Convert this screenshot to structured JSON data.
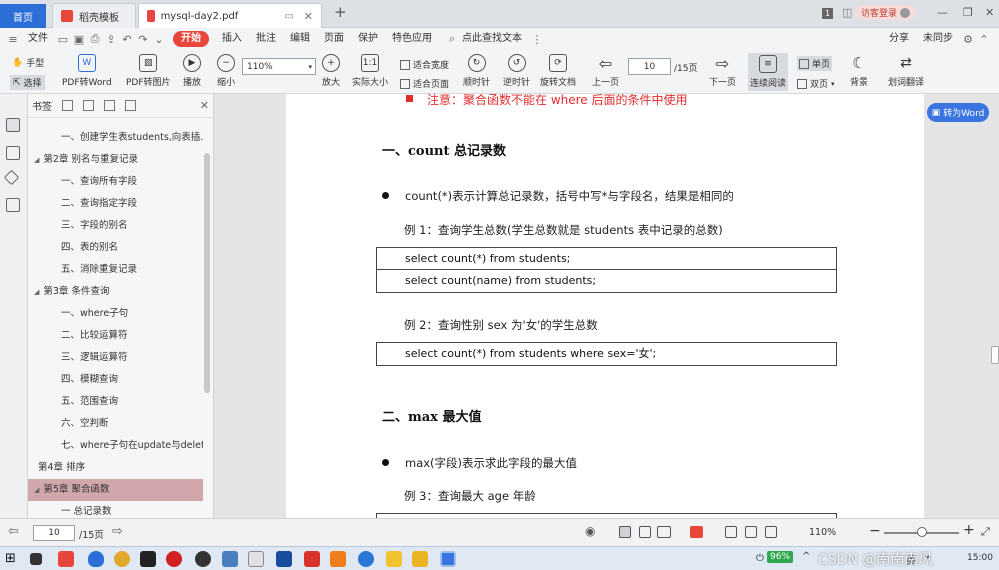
{
  "tabs": {
    "home": "首页",
    "template": "稻壳模板",
    "file": "mysql-day2.pdf",
    "new_tab": "+",
    "page_badge": "1",
    "login": "访客登录"
  },
  "menu": {
    "file": "文件",
    "start": "开始",
    "insert": "插入",
    "annotate": "批注",
    "edit": "编辑",
    "page": "页面",
    "protect": "保护",
    "features": "特色应用",
    "search": "点此查找文本",
    "share": "分享",
    "sync": "未同步"
  },
  "toolbar": {
    "hand": "手型",
    "select": "选择",
    "pdf_word": "PDF转Word",
    "pdf_img": "PDF转图片",
    "play": "播放",
    "zoom_out": "缩小",
    "zoom_value": "110%",
    "zoom_in": "放大",
    "actual": "实际大小",
    "fit_width": "适合宽度",
    "fit_page": "适合页面",
    "cw": "顺时针",
    "ccw": "逆时针",
    "rotate": "旋转文档",
    "prev": "上一页",
    "page_input": "10",
    "page_total": "/15页",
    "next": "下一页",
    "continuous": "连续阅读",
    "single": "单页",
    "double": "双页",
    "background": "背景",
    "translate": "划词翻译"
  },
  "outline": {
    "tab_label": "书签",
    "items": [
      {
        "text": "一、创建学生表students,向表插...",
        "level": 2
      },
      {
        "text": "第2章 别名与重复记录",
        "level": 1,
        "expanded": true
      },
      {
        "text": "一、查询所有字段",
        "level": 2
      },
      {
        "text": "二、查询指定字段",
        "level": 2
      },
      {
        "text": "三、字段的别名",
        "level": 2
      },
      {
        "text": "四、表的别名",
        "level": 2
      },
      {
        "text": "五、消除重复记录",
        "level": 2
      },
      {
        "text": "第3章 条件查询",
        "level": 1,
        "expanded": true
      },
      {
        "text": "一、where子句",
        "level": 2
      },
      {
        "text": "二、比较运算符",
        "level": 2
      },
      {
        "text": "三、逻辑运算符",
        "level": 2
      },
      {
        "text": "四、模糊查询",
        "level": 2
      },
      {
        "text": "五、范围查询",
        "level": 2
      },
      {
        "text": "六、空判断",
        "level": 2
      },
      {
        "text": "七、where子句在update与delet...",
        "level": 2
      },
      {
        "text": "第4章 排序",
        "level": 1
      },
      {
        "text": "第5章 聚合函数",
        "level": 1,
        "expanded": true,
        "selected": true
      },
      {
        "text": "一 总记录数",
        "level": 2
      }
    ]
  },
  "document": {
    "note": "注意：聚合函数不能在 where 后面的条件中使用",
    "section1": "一、count 总记录数",
    "bullet1": "count(*)表示计算总记录数，括号中写*与字段名，结果是相同的",
    "ex1": "例 1：查询学生总数(学生总数就是 students 表中记录的总数)",
    "code1": [
      "select count(*) from students;",
      "select count(name) from students;"
    ],
    "ex2": "例 2：查询性别 sex 为'女'的学生总数",
    "code2": [
      "select count(*) from students where sex='女';"
    ],
    "section2": "二、max 最大值",
    "bullet2": "max(字段)表示求此字段的最大值",
    "ex3": "例 3：查询最大 age 年龄"
  },
  "to_word": "转为Word",
  "status": {
    "page_input": "10",
    "page_total": "/15页",
    "zoom": "110%"
  },
  "taskbar": {
    "battery": "96%",
    "lang": "英",
    "time": "15:00",
    "watermark": "CSDN @南南南风"
  }
}
